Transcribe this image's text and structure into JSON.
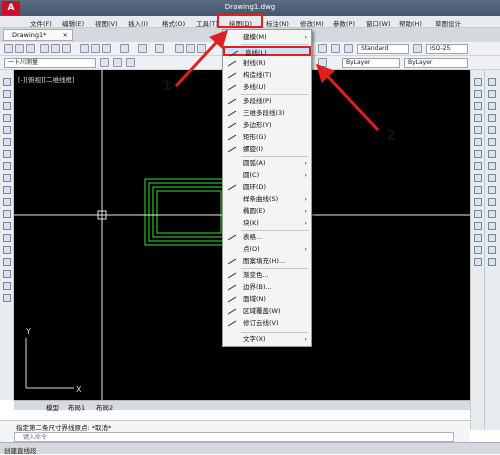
{
  "window": {
    "title": "Drawing1.dwg",
    "logo": "A"
  },
  "menubar": {
    "items": [
      "文件(F)",
      "编辑(E)",
      "视图(V)",
      "插入(I)",
      "格式(O)",
      "工具(T)",
      "绘图(D)",
      "标注(N)",
      "修改(M)",
      "参数(P)",
      "窗口(W)",
      "帮助(H)",
      "草图设计"
    ]
  },
  "tabs": {
    "doc": "Drawing1*",
    "close": "×"
  },
  "toolbar": {
    "style": "Standard",
    "dimstyle": "ISO-25",
    "linetype": "ByLayer",
    "layer": "一卜川测量"
  },
  "viewport": {
    "label": "[-][俯视][二维线框]"
  },
  "layout_tabs": [
    "模型",
    "布局1",
    "布局2"
  ],
  "command": {
    "history": "指定第二条尺寸界线原点: *取消*",
    "placeholder": "键入命令"
  },
  "status": {
    "text": "创建直线段"
  },
  "draw_menu": {
    "items": [
      {
        "label": "建模(M)",
        "submenu": true,
        "icon": "none"
      },
      {
        "label": "直线(L)",
        "submenu": false,
        "icon": "line-icon"
      },
      {
        "label": "射线(R)",
        "submenu": false,
        "icon": "ray-icon"
      },
      {
        "label": "构造线(T)",
        "submenu": false,
        "icon": "xline-icon"
      },
      {
        "label": "多线(U)",
        "submenu": false,
        "icon": "mline-icon"
      },
      {
        "label": "多段线(P)",
        "submenu": false,
        "icon": "polyline-icon"
      },
      {
        "label": "三维多段线(3)",
        "submenu": false,
        "icon": "3dpoly-icon"
      },
      {
        "label": "多边形(Y)",
        "submenu": false,
        "icon": "polygon-icon"
      },
      {
        "label": "矩形(G)",
        "submenu": false,
        "icon": "rectangle-icon"
      },
      {
        "label": "螺旋(I)",
        "submenu": false,
        "icon": "helix-icon"
      },
      {
        "label": "圆弧(A)",
        "submenu": true,
        "icon": "none"
      },
      {
        "label": "圆(C)",
        "submenu": true,
        "icon": "none"
      },
      {
        "label": "圆环(D)",
        "submenu": false,
        "icon": "donut-icon"
      },
      {
        "label": "样条曲线(S)",
        "submenu": true,
        "icon": "none"
      },
      {
        "label": "椭圆(E)",
        "submenu": true,
        "icon": "none"
      },
      {
        "label": "块(K)",
        "submenu": true,
        "icon": "none"
      },
      {
        "label": "表格...",
        "submenu": false,
        "icon": "table-icon"
      },
      {
        "label": "点(O)",
        "submenu": true,
        "icon": "none"
      },
      {
        "label": "图案填充(H)...",
        "submenu": false,
        "icon": "hatch-icon"
      },
      {
        "label": "渐变色...",
        "submenu": false,
        "icon": "gradient-icon"
      },
      {
        "label": "边界(B)...",
        "submenu": false,
        "icon": "boundary-icon"
      },
      {
        "label": "面域(N)",
        "submenu": false,
        "icon": "region-icon"
      },
      {
        "label": "区域覆盖(W)",
        "submenu": false,
        "icon": "wipeout-icon"
      },
      {
        "label": "修订云线(V)",
        "submenu": false,
        "icon": "revcloud-icon"
      },
      {
        "label": "文字(X)",
        "submenu": true,
        "icon": "none"
      }
    ],
    "arrow": "›"
  },
  "annotations": {
    "callout_1": "1",
    "callout_2": "2",
    "color": "#e02020"
  }
}
